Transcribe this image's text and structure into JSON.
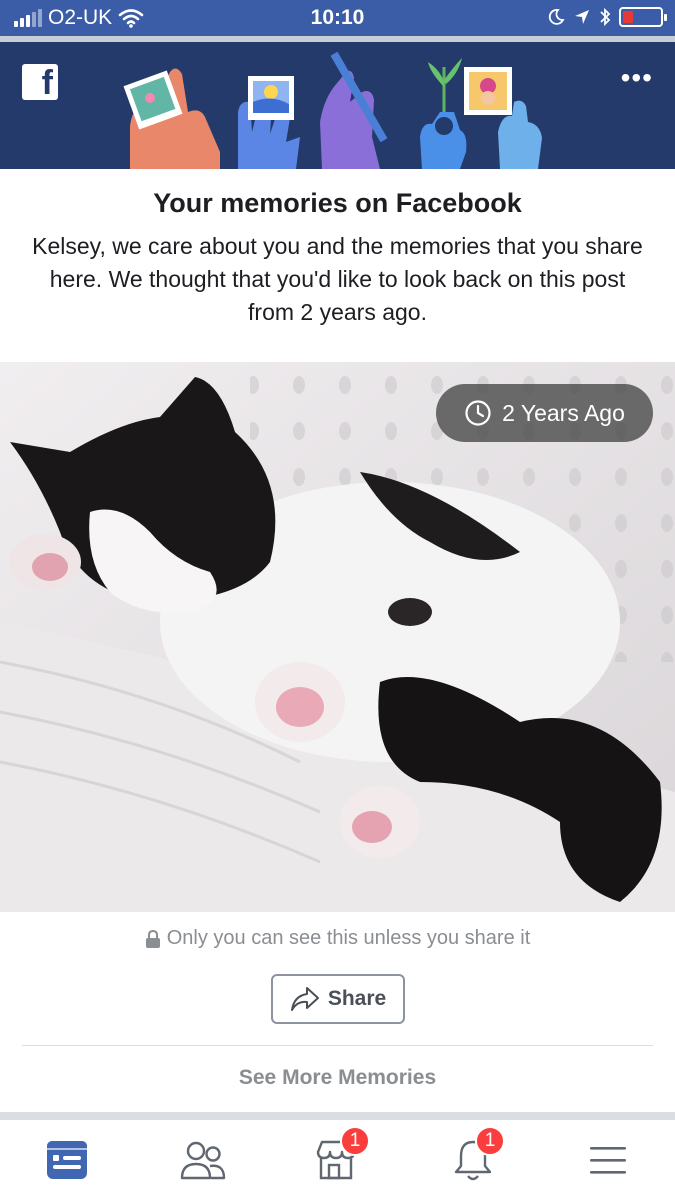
{
  "status_bar": {
    "carrier": "O2-UK",
    "time": "10:10",
    "battery_color": "#e53935"
  },
  "header": {
    "logo_letter": "f",
    "more_label": "•••",
    "background_color": "#243a6b"
  },
  "memory": {
    "title": "Your memories on Facebook",
    "message": "Kelsey, we care about you and the memories that you share here. We thought that you'd like to look back on this post from 2 years ago.",
    "photo_badge": "2 Years Ago",
    "privacy_note": "Only you can see this unless you share it",
    "share_label": "Share",
    "see_more_label": "See More Memories"
  },
  "tab_bar": {
    "tabs": [
      {
        "icon": "news-feed-icon",
        "active": true
      },
      {
        "icon": "friends-icon",
        "active": false
      },
      {
        "icon": "marketplace-icon",
        "active": false,
        "badge": "1"
      },
      {
        "icon": "notifications-bell-icon",
        "active": false,
        "badge": "1"
      },
      {
        "icon": "menu-icon",
        "active": false
      }
    ],
    "accent_color": "#4267b2",
    "badge_color": "#fa3e3e"
  }
}
